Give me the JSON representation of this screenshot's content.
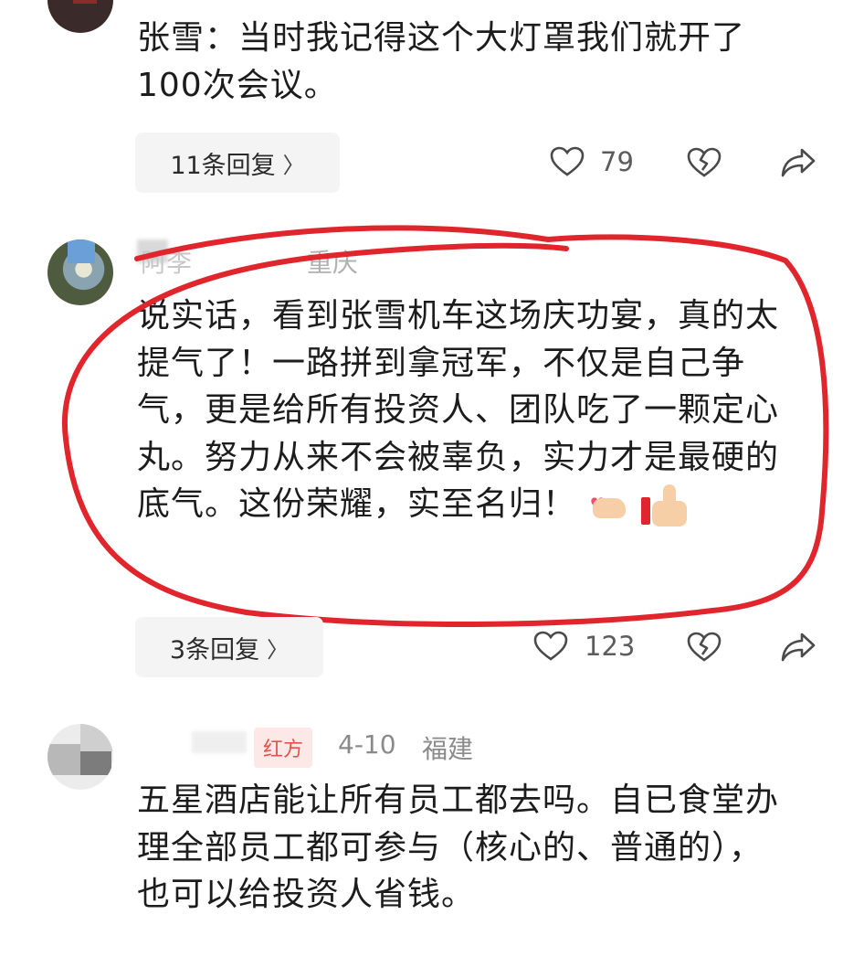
{
  "comments": [
    {
      "text": "张雪：当时我记得这个大灯罩我们就开了100次会议。",
      "reply_label": "11条回复",
      "likes": "79"
    },
    {
      "author": "阿李",
      "region": "重庆",
      "text": "说实话，看到张雪机车这场庆功宴，真的太提气了！一路拼到拿冠军，不仅是自己争气，更是给所有投资人、团队吃了一颗定心丸。努力从来不会被辜负，实力才是最硬的底气。这份荣耀，实至名归！",
      "emojis": [
        "heart-hands-emoji",
        "thumbs-up-emoji"
      ],
      "reply_label": "3条回复",
      "likes": "123"
    },
    {
      "badge": "红方",
      "date": "4-10",
      "region": "福建",
      "text": "五星酒店能让所有员工都去吗。自已食堂办理全部员工都可参与（核心的、普通的），也可以给投资人省钱。"
    }
  ],
  "colors": {
    "highlight": "#e0262c",
    "badge": "#e3534b",
    "meta": "#8a8a8a"
  },
  "icons": [
    "heart-icon",
    "dislike-icon",
    "share-icon",
    "chevron-right-icon"
  ]
}
